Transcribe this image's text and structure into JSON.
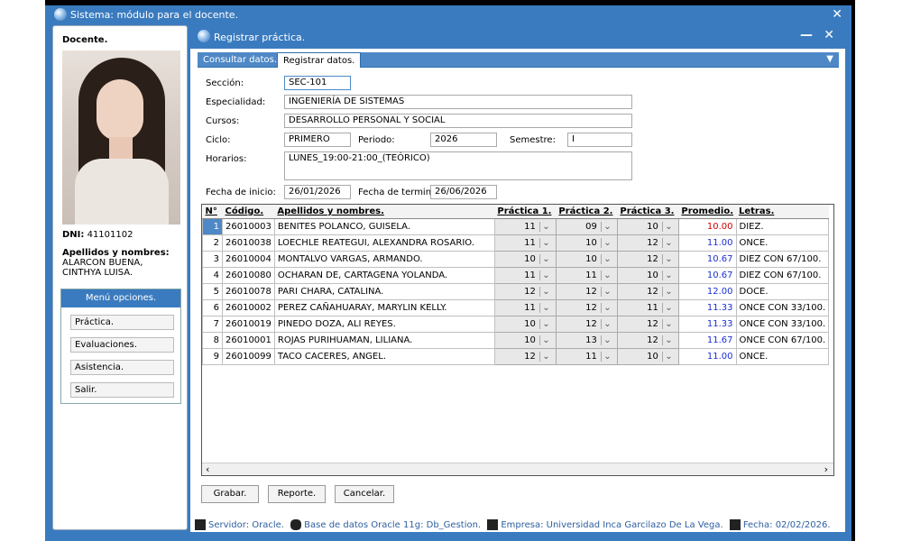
{
  "window": {
    "title": "Sistema: módulo para el docente.",
    "close_label": "✕"
  },
  "sidebar": {
    "docente_label": "Docente.",
    "dni_label": "DNI:",
    "dni_value": "41101102",
    "names_label": "Apellidos y nombres:",
    "names_line1": "ALARCON BUENA,",
    "names_line2": "CINTHYA LUISA.",
    "menu_title": "Menú opciones.",
    "menu_items": [
      "Práctica.",
      "Evaluaciones.",
      "Asistencia.",
      "Salir."
    ]
  },
  "subwindow": {
    "title": "Registrar práctica.",
    "min_label": "—",
    "close_label": "✕"
  },
  "tabs": [
    {
      "label": "Consultar datos."
    },
    {
      "label": "Registrar datos."
    }
  ],
  "form": {
    "seccion_label": "Sección:",
    "seccion": "SEC-101",
    "especialidad_label": "Especialidad:",
    "especialidad": "INGENIERÍA DE SISTEMAS",
    "cursos_label": "Cursos:",
    "cursos": "DESARROLLO PERSONAL Y SOCIAL",
    "ciclo_label": "Ciclo:",
    "ciclo": "PRIMERO",
    "periodo_label": "Periodo:",
    "periodo": "2026",
    "semestre_label": "Semestre:",
    "semestre": "I",
    "horarios_label": "Horarios:",
    "horarios": "LUNES_19:00-21:00_(TEÓRICO)",
    "fecha_inicio_label": "Fecha de inicio:",
    "fecha_inicio": "26/01/2026",
    "fecha_termino_label": "Fecha de termino:",
    "fecha_termino": "26/06/2026"
  },
  "table": {
    "headers": [
      "N°",
      "Código.",
      "Apellidos y nombres.",
      "Práctica 1.",
      "Práctica 2.",
      "Práctica 3.",
      "Promedio.",
      "Letras."
    ],
    "rows": [
      {
        "n": "1",
        "codigo": "26010003",
        "nombre": "BENITES POLANCO, GUISELA.",
        "p1": "11",
        "p2": "09",
        "p3": "10",
        "prom": "10.00",
        "letras": "DIEZ."
      },
      {
        "n": "2",
        "codigo": "26010038",
        "nombre": "LOECHLE REATEGUI, ALEXANDRA ROSARIO.",
        "p1": "11",
        "p2": "10",
        "p3": "12",
        "prom": "11.00",
        "letras": "ONCE."
      },
      {
        "n": "3",
        "codigo": "26010004",
        "nombre": "MONTALVO VARGAS, ARMANDO.",
        "p1": "10",
        "p2": "10",
        "p3": "12",
        "prom": "10.67",
        "letras": "DIEZ CON 67/100."
      },
      {
        "n": "4",
        "codigo": "26010080",
        "nombre": "OCHARAN DE, CARTAGENA YOLANDA.",
        "p1": "11",
        "p2": "11",
        "p3": "10",
        "prom": "10.67",
        "letras": "DIEZ CON 67/100."
      },
      {
        "n": "5",
        "codigo": "26010078",
        "nombre": "PARI CHARA, CATALINA.",
        "p1": "12",
        "p2": "12",
        "p3": "12",
        "prom": "12.00",
        "letras": "DOCE."
      },
      {
        "n": "6",
        "codigo": "26010002",
        "nombre": "PEREZ CAÑAHUARAY, MARYLIN KELLY.",
        "p1": "11",
        "p2": "12",
        "p3": "11",
        "prom": "11.33",
        "letras": "ONCE CON 33/100."
      },
      {
        "n": "7",
        "codigo": "26010019",
        "nombre": "PINEDO DOZA, ALI REYES.",
        "p1": "10",
        "p2": "12",
        "p3": "12",
        "prom": "11.33",
        "letras": "ONCE CON 33/100."
      },
      {
        "n": "8",
        "codigo": "26010001",
        "nombre": "ROJAS PURIHUAMAN, LILIANA.",
        "p1": "10",
        "p2": "13",
        "p3": "12",
        "prom": "11.67",
        "letras": "ONCE CON 67/100."
      },
      {
        "n": "9",
        "codigo": "26010099",
        "nombre": "TACO CACERES, ANGEL.",
        "p1": "12",
        "p2": "11",
        "p3": "10",
        "prom": "11.00",
        "letras": "ONCE."
      }
    ]
  },
  "buttons": {
    "grabar": "Grabar.",
    "reporte": "Reporte.",
    "cancelar": "Cancelar."
  },
  "status": {
    "servidor": "Servidor: Oracle.",
    "base": "Base de datos Oracle 11g: Db_Gestion.",
    "empresa": "Empresa: Universidad Inca Garcilazo De La Vega.",
    "fecha": "Fecha: 02/02/2026."
  },
  "colors": {
    "accent": "#3a7bbf",
    "prom_red": "#d40000",
    "prom_blue": "#1a2fd4"
  }
}
